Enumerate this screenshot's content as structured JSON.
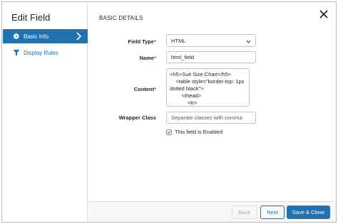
{
  "sidebar": {
    "title": "Edit Field",
    "items": [
      {
        "label": "Basic Info",
        "icon": "gear-icon",
        "active": true
      },
      {
        "label": "Display Rules",
        "icon": "filter-icon",
        "active": false
      }
    ]
  },
  "main": {
    "section_title": "BASIC DETAILS",
    "fields": {
      "field_type": {
        "label": "Field Type",
        "required_mark": "*",
        "value": "HTML"
      },
      "name": {
        "label": "Name",
        "required_mark": "*",
        "value": "html_field"
      },
      "content": {
        "label": "Content",
        "required_mark": "*",
        "lines": [
          "<h5>Suit Size Chart</h5>",
          "    <table style=\"border-top: 1px",
          "dotted black\">",
          "        <thead>",
          "            <tr>"
        ]
      },
      "wrapper_class": {
        "label": "Wrapper Class",
        "placeholder": "Separate classes with comma"
      }
    },
    "enabled_checkbox": {
      "label": "This field is Enabled",
      "checked": true
    }
  },
  "footer": {
    "back_label": "Back",
    "next_label": "Next",
    "save_label": "Save & Close"
  },
  "colors": {
    "accent": "#2271b1",
    "required": "#d63638",
    "footer_bg": "#f6f7f7"
  }
}
